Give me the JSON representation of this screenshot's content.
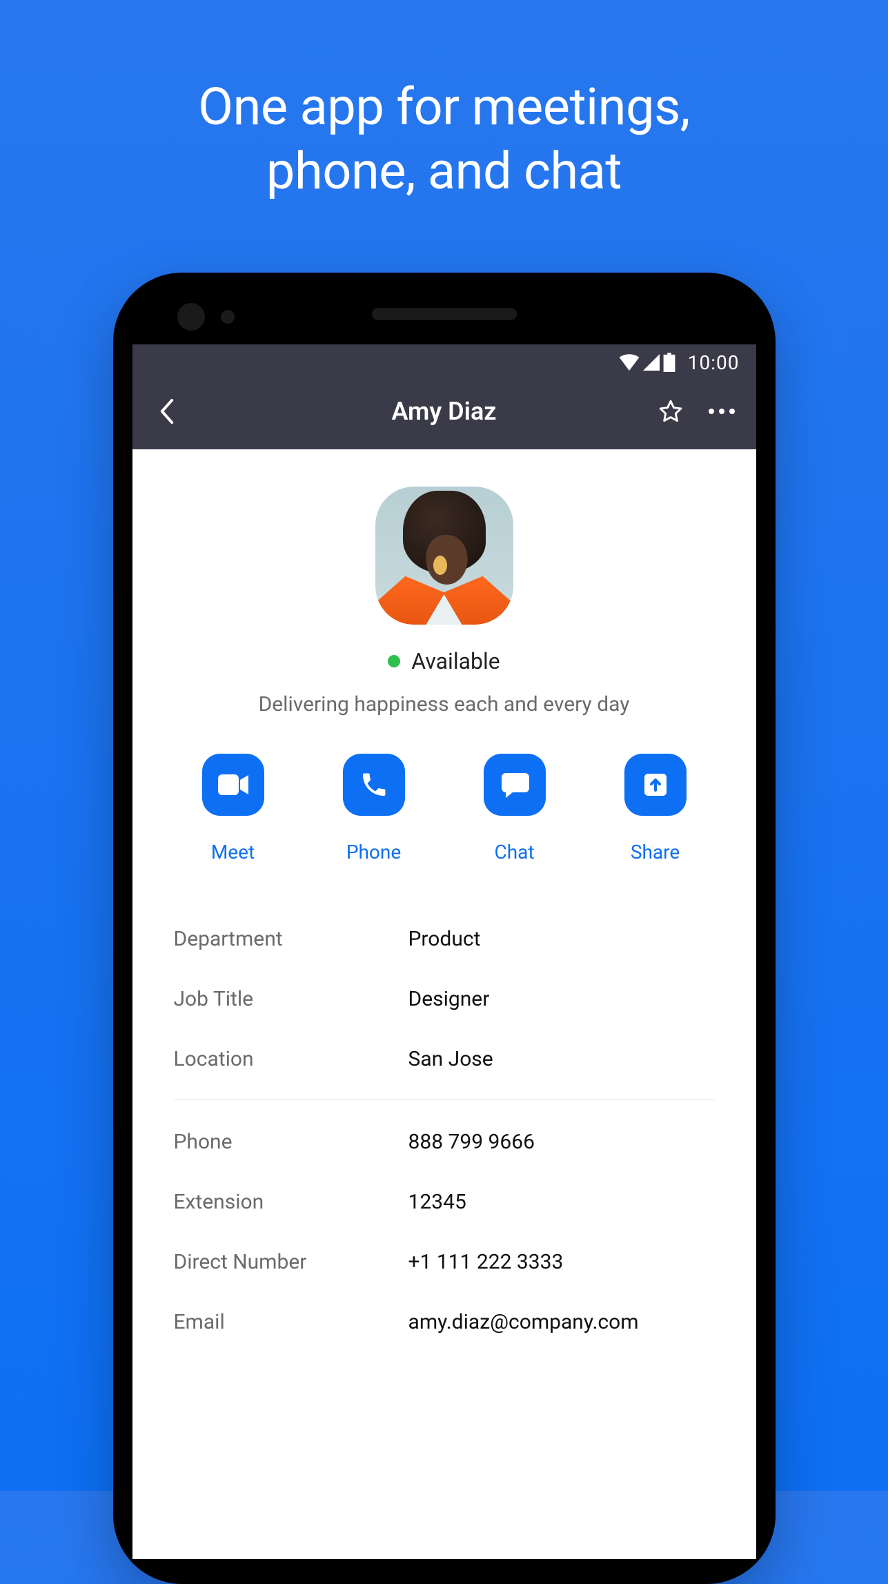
{
  "marketing": {
    "tagline_line1": "One app for meetings,",
    "tagline_line2": "phone, and chat"
  },
  "status_bar": {
    "time": "10:00"
  },
  "app_bar": {
    "title": "Amy Diaz"
  },
  "profile": {
    "status_text": "Available",
    "status_color": "#2fbf4a",
    "bio": "Delivering happiness each and every day"
  },
  "actions": {
    "meet": "Meet",
    "phone": "Phone",
    "chat": "Chat",
    "share": "Share"
  },
  "details_section1": [
    {
      "label": "Department",
      "value": "Product"
    },
    {
      "label": "Job Title",
      "value": "Designer"
    },
    {
      "label": "Location",
      "value": "San Jose"
    }
  ],
  "details_section2": [
    {
      "label": "Phone",
      "value": "888 799 9666"
    },
    {
      "label": "Extension",
      "value": "12345"
    },
    {
      "label": "Direct Number",
      "value": "+1 111 222 3333"
    },
    {
      "label": "Email",
      "value": "amy.diaz@company.com"
    }
  ],
  "colors": {
    "accent": "#0d6ff3",
    "appbar": "#3a3a49"
  }
}
